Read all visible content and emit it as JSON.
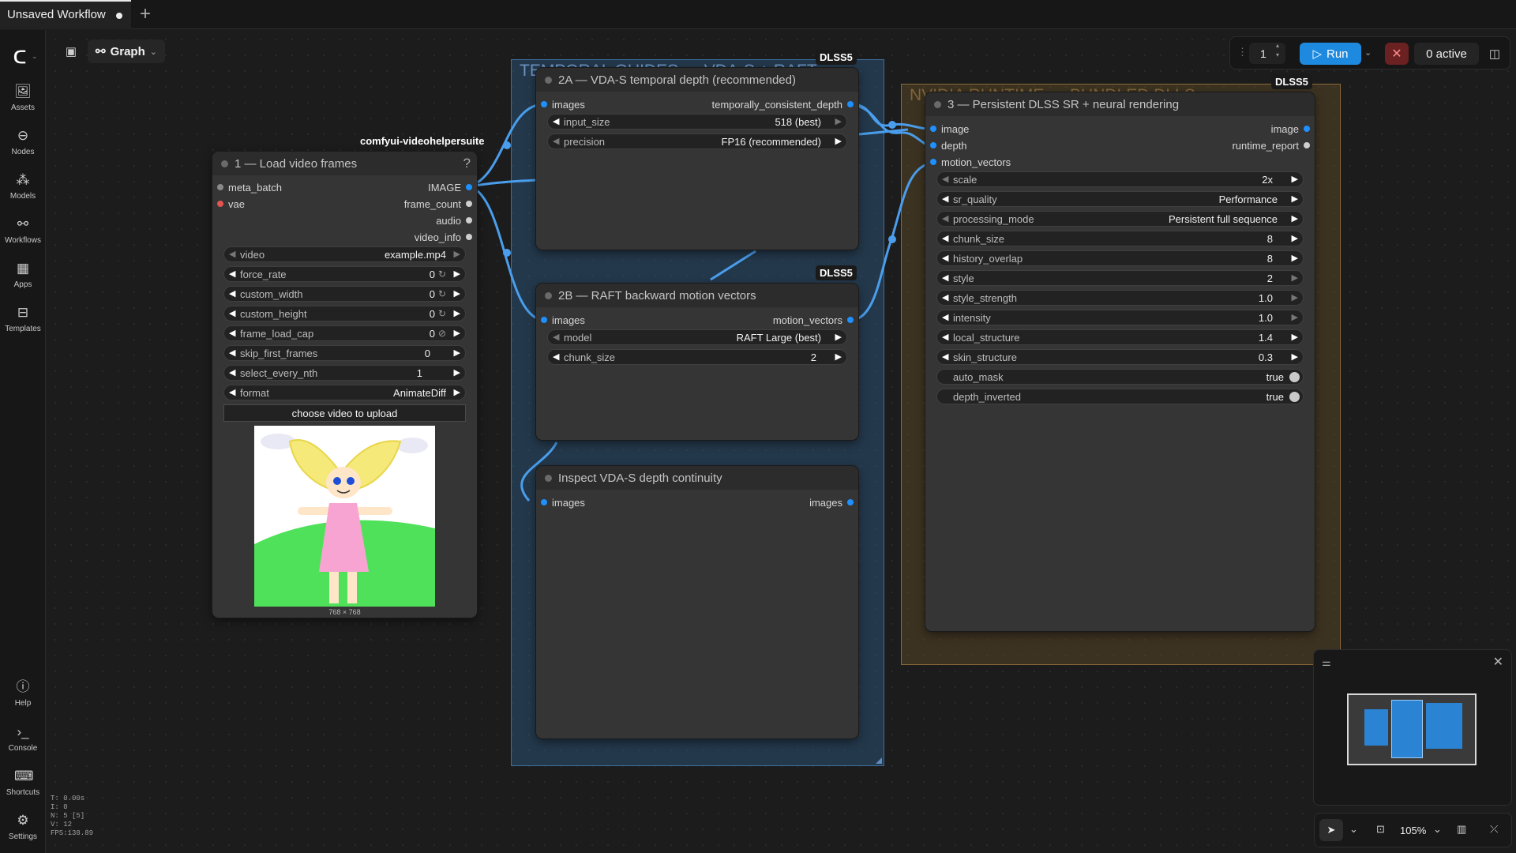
{
  "tab": {
    "title": "Unsaved Workflow",
    "new_tab_icon": "plus-icon"
  },
  "sidebar": {
    "items": [
      {
        "label": "Assets",
        "icon": "image-icon"
      },
      {
        "label": "Nodes",
        "icon": "node-icon"
      },
      {
        "label": "Models",
        "icon": "models-icon"
      },
      {
        "label": "Workflows",
        "icon": "workflow-icon"
      },
      {
        "label": "Apps",
        "icon": "apps-icon"
      },
      {
        "label": "Templates",
        "icon": "templates-icon"
      }
    ],
    "bottom": [
      {
        "label": "Help",
        "icon": "help-icon"
      },
      {
        "label": "Console",
        "icon": "console-icon"
      },
      {
        "label": "Shortcuts",
        "icon": "keyboard-icon"
      },
      {
        "label": "Settings",
        "icon": "gear-icon"
      }
    ]
  },
  "stats": [
    "T: 0.00s",
    "I: 0",
    "N: 5 [5]",
    "V: 12",
    "FPS:138.89"
  ],
  "toolbar": {
    "graph_label": "Graph"
  },
  "runbar": {
    "queue_count": "1",
    "run_label": "Run",
    "active_label": "0 active"
  },
  "groups": {
    "blue_title": "TEMPORAL GUIDES — VDA-S + RAFT",
    "gold_title": "NVIDIA RUNTIME — BUNDLED DLLS"
  },
  "node1": {
    "badge": "comfyui-videohelpersuite",
    "title": "1 — Load video frames",
    "help": "?",
    "inputs": [
      "meta_batch",
      "vae"
    ],
    "outputs": [
      "IMAGE",
      "frame_count",
      "audio",
      "video_info"
    ],
    "widgets": [
      {
        "label": "video",
        "value": "example.mp4"
      },
      {
        "label": "force_rate",
        "value": "0"
      },
      {
        "label": "custom_width",
        "value": "0"
      },
      {
        "label": "custom_height",
        "value": "0"
      },
      {
        "label": "frame_load_cap",
        "value": "0"
      },
      {
        "label": "skip_first_frames",
        "value": "0"
      },
      {
        "label": "select_every_nth",
        "value": "1"
      },
      {
        "label": "format",
        "value": "AnimateDiff"
      }
    ],
    "upload_label": "choose video to upload",
    "image_size": "768 × 768"
  },
  "node2a": {
    "badge": "DLSS5",
    "title": "2A — VDA-S temporal depth (recommended)",
    "input": "images",
    "output": "temporally_consistent_depth",
    "widgets": [
      {
        "label": "input_size",
        "value": "518 (best)"
      },
      {
        "label": "precision",
        "value": "FP16 (recommended)"
      }
    ]
  },
  "node2b": {
    "badge": "DLSS5",
    "title": "2B — RAFT backward motion vectors",
    "input": "images",
    "output": "motion_vectors",
    "widgets": [
      {
        "label": "model",
        "value": "RAFT Large (best)"
      },
      {
        "label": "chunk_size",
        "value": "2"
      }
    ]
  },
  "node_inspect": {
    "title": "Inspect VDA-S depth continuity",
    "input": "images",
    "output": "images"
  },
  "node3": {
    "badge": "DLSS5",
    "title": "3 — Persistent DLSS SR + neural rendering",
    "inputs": [
      "image",
      "depth",
      "motion_vectors"
    ],
    "outputs": [
      "image",
      "runtime_report"
    ],
    "widgets": [
      {
        "label": "scale",
        "value": "2x"
      },
      {
        "label": "sr_quality",
        "value": "Performance"
      },
      {
        "label": "processing_mode",
        "value": "Persistent full sequence"
      },
      {
        "label": "chunk_size",
        "value": "8"
      },
      {
        "label": "history_overlap",
        "value": "8"
      },
      {
        "label": "style",
        "value": "2"
      },
      {
        "label": "style_strength",
        "value": "1.0"
      },
      {
        "label": "intensity",
        "value": "1.0"
      },
      {
        "label": "local_structure",
        "value": "1.4"
      },
      {
        "label": "skin_structure",
        "value": "0.3"
      }
    ],
    "toggles": [
      {
        "label": "auto_mask",
        "value": "true"
      },
      {
        "label": "depth_inverted",
        "value": "true"
      }
    ]
  },
  "zoom": {
    "level": "105%"
  },
  "colors": {
    "link": "#4a9eed",
    "run": "#1d8ae0",
    "group_blue": "#2d5f8c",
    "group_gold": "#6a5028"
  }
}
